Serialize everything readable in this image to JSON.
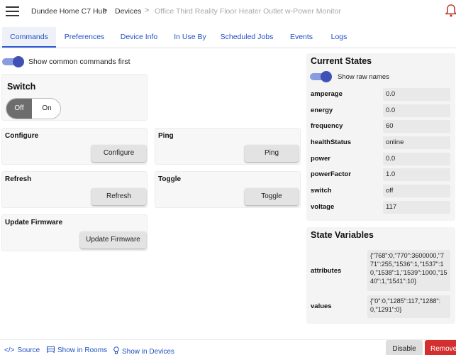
{
  "breadcrumb": {
    "hub": "Dundee Home C7 Hub",
    "devices": "Devices",
    "device": "Office Third Reality Floor Heater Outlet w-Power Monitor",
    "separator": ">"
  },
  "icons": {
    "menu": "hamburger-icon",
    "notifications": "bell-icon",
    "source": "code-icon",
    "rooms": "rooms-icon",
    "devices": "bulb-icon"
  },
  "tabs": [
    {
      "label": "Commands",
      "active": true
    },
    {
      "label": "Preferences"
    },
    {
      "label": "Device Info"
    },
    {
      "label": "In Use By"
    },
    {
      "label": "Scheduled Jobs"
    },
    {
      "label": "Events"
    },
    {
      "label": "Logs"
    }
  ],
  "commands": {
    "common_first_label": "Show common commands first",
    "common_first_on": true,
    "switch": {
      "title": "Switch",
      "off_label": "Off",
      "on_label": "On",
      "selected": "Off"
    },
    "cards": [
      {
        "title": "Configure",
        "button": "Configure"
      },
      {
        "title": "Ping",
        "button": "Ping"
      },
      {
        "title": "Refresh",
        "button": "Refresh"
      },
      {
        "title": "Toggle",
        "button": "Toggle"
      },
      {
        "title": "Update Firmware",
        "button": "Update Firmware"
      }
    ]
  },
  "current_states": {
    "title": "Current States",
    "raw_names_label": "Show raw names",
    "raw_names_on": true,
    "rows": [
      {
        "name": "amperage",
        "value": "0.0"
      },
      {
        "name": "energy",
        "value": "0.0"
      },
      {
        "name": "frequency",
        "value": "60"
      },
      {
        "name": "healthStatus",
        "value": "online"
      },
      {
        "name": "power",
        "value": "0.0"
      },
      {
        "name": "powerFactor",
        "value": "1.0"
      },
      {
        "name": "switch",
        "value": "off"
      },
      {
        "name": "voltage",
        "value": "117"
      }
    ]
  },
  "state_variables": {
    "title": "State Variables",
    "rows": [
      {
        "name": "attributes",
        "value": "{\"768\":0,\"770\":3600000,\"771\":255,\"1536\":1,\"1537\":10,\"1538\":1,\"1539\":1000,\"1540\":1,\"1541\":10}"
      },
      {
        "name": "values",
        "value": "{\"0\":0,\"1285\":117,\"1288\":0,\"1291\":0}"
      }
    ]
  },
  "footer": {
    "source": "Source",
    "rooms": "Show in Rooms",
    "devices": "Show in Devices",
    "disable": "Disable",
    "remove": "Remove"
  },
  "colors": {
    "accent": "#3f51b5",
    "link": "#1f4fc4",
    "danger": "#d32f2f"
  }
}
